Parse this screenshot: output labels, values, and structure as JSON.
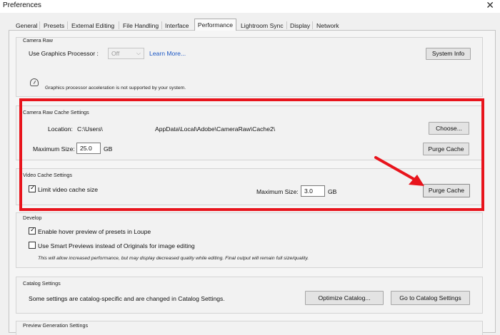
{
  "window": {
    "title": "Preferences",
    "close_glyph": "✕"
  },
  "tabs": [
    "General",
    "Presets",
    "External Editing",
    "File Handling",
    "Interface",
    "Performance",
    "Lightroom Sync",
    "Display",
    "Network"
  ],
  "active_tab": "Performance",
  "camera_raw": {
    "title": "Camera Raw",
    "gpu_label": "Use Graphics Processor :",
    "gpu_value": "Off",
    "learn_more": "Learn More...",
    "system_info": "System Info",
    "gpu_note": "Graphics processor acceleration is not supported by your system.",
    "gauge_icon": "gauge-icon"
  },
  "cache": {
    "title": "Camera Raw Cache Settings",
    "location_label": "Location:",
    "location_part1": "C:\\Users\\",
    "location_part2": "AppData\\Local\\Adobe\\CameraRaw\\Cache2\\",
    "choose": "Choose...",
    "max_size_label": "Maximum Size:",
    "max_size_value": "25.0",
    "unit": "GB",
    "purge": "Purge Cache"
  },
  "video_cache": {
    "title": "Video Cache Settings",
    "limit_label": "Limit video cache size",
    "limit_checked": true,
    "max_size_label": "Maximum Size:",
    "max_size_value": "3.0",
    "unit": "GB",
    "purge": "Purge Cache"
  },
  "develop": {
    "title": "Develop",
    "hover_preview": "Enable hover preview of presets in Loupe",
    "hover_checked": true,
    "smart_previews": "Use Smart Previews instead of Originals for image editing",
    "smart_checked": false,
    "note": "This will allow increased performance, but may display decreased quality while editing. Final output will remain full size/quality."
  },
  "catalog": {
    "title": "Catalog Settings",
    "text": "Some settings are catalog-specific and are changed in Catalog Settings.",
    "optimize": "Optimize Catalog...",
    "goto": "Go to Catalog Settings"
  },
  "preview": {
    "title": "Preview Generation Settings"
  },
  "annotation": {
    "highlight_color": "#e8141c"
  }
}
